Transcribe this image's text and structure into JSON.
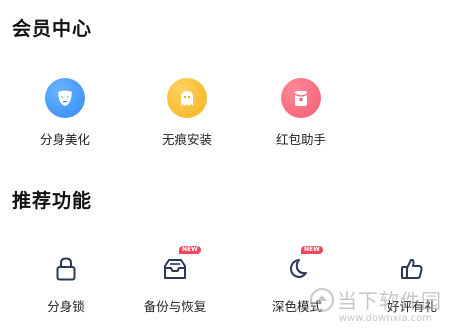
{
  "vip_center": {
    "title": "会员中心",
    "items": [
      {
        "label": "分身美化",
        "icon": "mask-icon",
        "color": "#3a92f7"
      },
      {
        "label": "无痕安装",
        "icon": "ghost-icon",
        "color": "#f9bb2d"
      },
      {
        "label": "红包助手",
        "icon": "red-packet-icon",
        "color": "#f4677a"
      }
    ]
  },
  "recommended": {
    "title": "推荐功能",
    "items": [
      {
        "label": "分身锁",
        "icon": "lock-icon",
        "badge": ""
      },
      {
        "label": "备份与恢复",
        "icon": "backup-tray-icon",
        "badge": "NEW"
      },
      {
        "label": "深色模式",
        "icon": "moon-icon",
        "badge": "NEW"
      },
      {
        "label": "好评有礼",
        "icon": "thumbs-up-icon",
        "badge": ""
      }
    ]
  },
  "watermark": {
    "text": "当下软件园",
    "url": "www.downxia.com"
  },
  "colors": {
    "badge": "#f2455e",
    "icon_stroke": "#2b3a55"
  }
}
